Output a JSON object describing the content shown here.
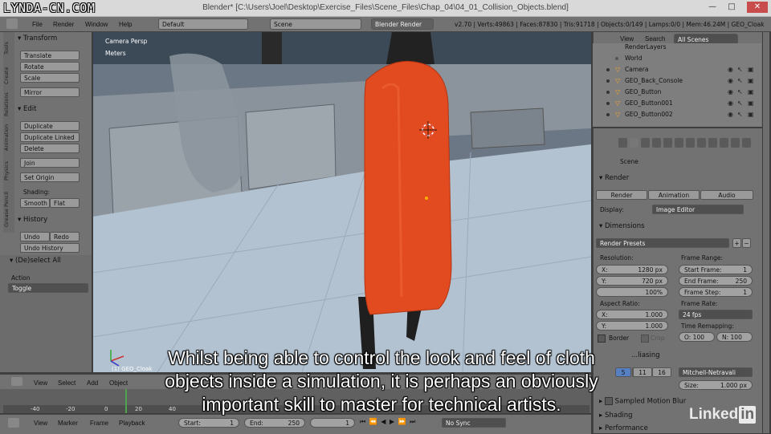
{
  "watermark": "LYNDA-CN.COM",
  "window": {
    "title": "Blender* [C:\\Users\\Joel\\Desktop\\Exercise_Files\\Scene_Files\\Chap_04\\04_01_Collision_Objects.blend]",
    "min": "—",
    "max": "□",
    "close": "✕"
  },
  "info_header": {
    "menus": [
      "File",
      "Render",
      "Window",
      "Help"
    ],
    "layout": "Default",
    "scene": "Scene",
    "engine": "Blender Render",
    "stats": "v2.70 | Verts:49863 | Faces:87830 | Tris:91718 | Objects:0/149 | Lamps:0/0 | Mem:46.24M | GEO_Cloak"
  },
  "tool_shelf": {
    "tabs": [
      "Tools",
      "Create",
      "Relations",
      "Animation",
      "Physics",
      "Grease Pencil"
    ],
    "transform": {
      "header": "Transform",
      "buttons": [
        "Translate",
        "Rotate",
        "Scale",
        "Mirror"
      ]
    },
    "edit": {
      "header": "Edit",
      "buttons": [
        "Duplicate",
        "Duplicate Linked",
        "Delete",
        "Join",
        "Set Origin"
      ]
    },
    "shading": {
      "label": "Shading:",
      "smooth": "Smooth",
      "flat": "Flat"
    },
    "history": {
      "header": "History",
      "undo": "Undo",
      "redo": "Redo",
      "undo_history": "Undo History"
    },
    "operator": {
      "header": "(De)select All",
      "action_label": "Action",
      "action_value": "Toggle"
    }
  },
  "viewport": {
    "view_name": "Camera Persp",
    "units": "Meters",
    "active_object": "(1) GEO_Cloak"
  },
  "subtitle": [
    "Whilst being able to control the look and feel of cloth",
    "objects inside a simulation, it is perhaps an obviously",
    "important skill to master for technical artists."
  ],
  "outliner": {
    "menus": [
      "View",
      "Search"
    ],
    "filter": "All Scenes",
    "rows": [
      "RenderLayers",
      "World",
      "Camera",
      "GEO_Back_Console",
      "GEO_Button",
      "GEO_Button001",
      "GEO_Button002"
    ]
  },
  "properties": {
    "context": "Scene",
    "render": {
      "header": "Render",
      "buttons": [
        "Render",
        "Animation",
        "Audio"
      ],
      "display_label": "Display:",
      "display_value": "Image Editor"
    },
    "dimensions": {
      "header": "Dimensions",
      "presets": "Render Presets",
      "resolution_label": "Resolution:",
      "res_x": "1280 px",
      "res_y": "720 px",
      "res_pct": "100%",
      "frame_range_label": "Frame Range:",
      "start_frame": "1",
      "end_frame": "250",
      "frame_step": "1",
      "aspect_label": "Aspect Ratio:",
      "aspect_x": "1.000",
      "aspect_y": "1.000",
      "frame_rate_label": "Frame Rate:",
      "frame_rate": "24 fps",
      "border": "Border",
      "crop": "Crop",
      "time_remap_label": "Time Remapping:",
      "old": "O: 100",
      "new": "N: 100"
    },
    "antialiasing": {
      "header_fragment": "...liasing",
      "samples": [
        "5",
        "8",
        "11",
        "16"
      ],
      "filter": "Mitchell-Netravali",
      "size": "Size:",
      "size_value": "1.000 px"
    },
    "sampled_motion_blur": "Sampled Motion Blur",
    "shading": "Shading",
    "performance": "Performance"
  },
  "timeline": {
    "header_menus": [
      "View",
      "Select",
      "Add",
      "Object"
    ],
    "ticks": [
      "-40",
      "-20",
      "0",
      "20",
      "40"
    ],
    "footer_menus": [
      "View",
      "Marker",
      "Frame",
      "Playback"
    ],
    "start_label": "Start:",
    "start": "1",
    "end_label": "End:",
    "end": "250",
    "current": "1",
    "sync": "No Sync"
  },
  "linkedin": {
    "text": "Linked",
    "in": "in"
  }
}
